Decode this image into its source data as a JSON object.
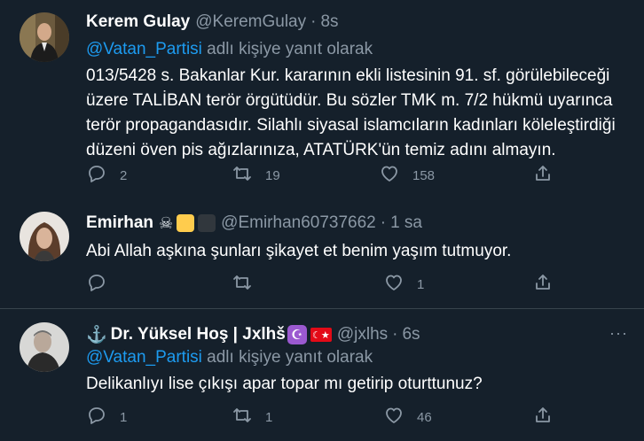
{
  "tweets": [
    {
      "name": "Kerem Gulay",
      "handle": "@KeremGulay",
      "dot": "·",
      "time": "8s",
      "reply_mention": "@Vatan_Partisi",
      "reply_suffix": " adlı kişiye yanıt olarak",
      "lines": [
        "013/5428 s. Bakanlar Kur. kararının ekli listesinin 91. sf. görülebileceği",
        "üzere TALİBAN terör örgütüdür. Bu sözler TMK m. 7/2 hükmü uyarınca",
        "terör propagandasıdır. Silahlı siyasal islamcıların kadınları köleleştirdiği",
        "düzeni öven pis ağızlarınıza, ATATÜRK'ün temiz adını almayın."
      ],
      "replies": "2",
      "retweets": "19",
      "likes": "158"
    },
    {
      "name": "Emirhan",
      "name_emoji": "☠",
      "handle": "@Emirhan60737662",
      "dot": "·",
      "time": "1 sa",
      "lines": [
        "Abi Allah aşkına şunları şikayet et benim yaşım tutmuyor."
      ],
      "replies": "",
      "retweets": "",
      "likes": "1"
    },
    {
      "name_prefix": "⚓",
      "name": "Dr. Yüksel Hoş | Jxlhš",
      "name_crescent": "☪",
      "name_flag": "☾★",
      "handle": "@jxlhs",
      "dot": "·",
      "time": "6s",
      "more": "···",
      "reply_mention": "@Vatan_Partisi",
      "reply_suffix": " adlı kişiye yanıt olarak",
      "lines": [
        "Delikanlıyı lise çıkışı apar topar mı getirip oturttunuz?"
      ],
      "replies": "1",
      "retweets": "1",
      "likes": "46"
    }
  ],
  "icons": {
    "reply": "reply-icon",
    "retweet": "retweet-icon",
    "like": "heart-icon",
    "share": "share-icon",
    "more": "more-icon"
  },
  "colors": {
    "background": "#15202b",
    "accent": "#1d9bf0",
    "secondary_text": "#8b98a5",
    "divider": "#38444d",
    "emoji_yellow": "#ffcc4d",
    "emoji_black": "#31373d"
  }
}
